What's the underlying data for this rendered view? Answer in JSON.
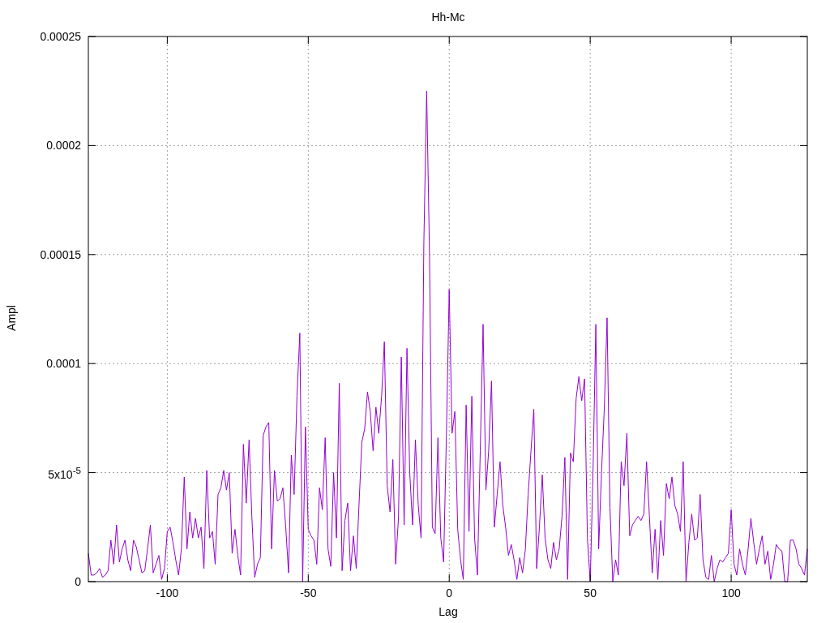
{
  "chart": {
    "chart_data": {
      "type": "line",
      "title": "Hh-Mc",
      "xlabel": "Lag",
      "ylabel": "Ampl",
      "x": [
        -128,
        -127,
        -126,
        -125,
        -124,
        -123,
        -122,
        -121,
        -120,
        -119,
        -118,
        -117,
        -116,
        -115,
        -114,
        -113,
        -112,
        -111,
        -110,
        -109,
        -108,
        -107,
        -106,
        -105,
        -104,
        -103,
        -102,
        -101,
        -100,
        -99,
        -98,
        -97,
        -96,
        -95,
        -94,
        -93,
        -92,
        -91,
        -90,
        -89,
        -88,
        -87,
        -86,
        -85,
        -84,
        -83,
        -82,
        -81,
        -80,
        -79,
        -78,
        -77,
        -76,
        -75,
        -74,
        -73,
        -72,
        -71,
        -70,
        -69,
        -68,
        -67,
        -66,
        -65,
        -64,
        -63,
        -62,
        -61,
        -60,
        -59,
        -58,
        -57,
        -56,
        -55,
        -54,
        -53,
        -52,
        -51,
        -50,
        -49,
        -48,
        -47,
        -46,
        -45,
        -44,
        -43,
        -42,
        -41,
        -40,
        -39,
        -38,
        -37,
        -36,
        -35,
        -34,
        -33,
        -32,
        -31,
        -30,
        -29,
        -28,
        -27,
        -26,
        -25,
        -24,
        -23,
        -22,
        -21,
        -20,
        -19,
        -18,
        -17,
        -16,
        -15,
        -14,
        -13,
        -12,
        -11,
        -10,
        -9,
        -8,
        -7,
        -6,
        -5,
        -4,
        -3,
        -2,
        -1,
        0,
        1,
        2,
        3,
        4,
        5,
        6,
        7,
        8,
        9,
        10,
        11,
        12,
        13,
        14,
        15,
        16,
        17,
        18,
        19,
        20,
        21,
        22,
        23,
        24,
        25,
        26,
        27,
        28,
        29,
        30,
        31,
        32,
        33,
        34,
        35,
        36,
        37,
        38,
        39,
        40,
        41,
        42,
        43,
        44,
        45,
        46,
        47,
        48,
        49,
        50,
        51,
        52,
        53,
        54,
        55,
        56,
        57,
        58,
        59,
        60,
        61,
        62,
        63,
        64,
        65,
        66,
        67,
        68,
        69,
        70,
        71,
        72,
        73,
        74,
        75,
        76,
        77,
        78,
        79,
        80,
        81,
        82,
        83,
        84,
        85,
        86,
        87,
        88,
        89,
        90,
        91,
        92,
        93,
        94,
        95,
        96,
        97,
        98,
        99,
        100,
        101,
        102,
        103,
        104,
        105,
        106,
        107,
        108,
        109,
        110,
        111,
        112,
        113,
        114,
        115,
        116,
        117,
        118,
        119,
        120,
        121,
        122,
        123,
        124,
        125,
        126,
        127
      ],
      "grid": true,
      "series": [
        {
          "color": "#9400d3",
          "values": [
            1.3e-05,
            3e-06,
            3e-06,
            4e-06,
            6e-06,
            2e-06,
            3e-06,
            5e-06,
            1.9e-05,
            8e-06,
            2.6e-05,
            9e-06,
            1.5e-05,
            1.9e-05,
            1e-05,
            5e-06,
            1.9e-05,
            1.6e-05,
            1e-05,
            4e-06,
            5e-06,
            1.5e-05,
            2.6e-05,
            4e-06,
            8e-06,
            1.2e-05,
            1e-06,
            6e-06,
            2.3e-05,
            2.5e-05,
            1.8e-05,
            1e-05,
            3e-06,
            1.5e-05,
            4.8e-05,
            1.5e-05,
            3.2e-05,
            2e-05,
            2.9e-05,
            2e-05,
            2.5e-05,
            6e-06,
            5.1e-05,
            2e-05,
            2.3e-05,
            8e-06,
            4e-05,
            4.3e-05,
            5.1e-05,
            4.2e-05,
            5e-05,
            1.3e-05,
            2.4e-05,
            1.2e-05,
            3e-06,
            6.3e-05,
            3.6e-05,
            6.5e-05,
            3e-05,
            2e-06,
            8e-06,
            1.1e-05,
            6.7e-05,
            7.1e-05,
            7.3e-05,
            1.5e-05,
            5.1e-05,
            3.7e-05,
            3.8e-05,
            4.3e-05,
            2.5e-05,
            4e-06,
            5.8e-05,
            4e-05,
            8.5e-05,
            0.000114,
            0,
            7.1e-05,
            2.4e-05,
            2.1e-05,
            1.9e-05,
            8e-06,
            4.3e-05,
            3.3e-05,
            6.6e-05,
            1.5e-05,
            7e-06,
            5e-05,
            2e-05,
            9.1e-05,
            5e-06,
            2.8e-05,
            3.6e-05,
            5e-06,
            2.1e-05,
            6e-06,
            3.5e-05,
            6.4e-05,
            7e-05,
            8.7e-05,
            7.8e-05,
            6e-05,
            8e-05,
            6.8e-05,
            8.5e-05,
            0.00011,
            4.4e-05,
            3.2e-05,
            5.6e-05,
            8e-06,
            2.9e-05,
            0.000103,
            2.6e-05,
            0.000107,
            5e-05,
            2.6e-05,
            6.5e-05,
            3.5e-05,
            2e-05,
            0.000155,
            0.000225,
            0.00015,
            2.5e-05,
            2.2e-05,
            6.6e-05,
            2e-05,
            9e-06,
            6.8e-05,
            0.000134,
            6.8e-05,
            7.8e-05,
            2.4e-05,
            1e-05,
            1e-06,
            8.1e-05,
            2.3e-05,
            8.5e-05,
            2e-05,
            3e-06,
            6e-05,
            0.000118,
            4.2e-05,
            6e-05,
            9.2e-05,
            2.5e-05,
            4e-05,
            5.5e-05,
            3.5e-05,
            2.5e-05,
            1.2e-05,
            1.7e-05,
            1e-05,
            1e-06,
            1.1e-05,
            4e-06,
            1.5e-05,
            4e-05,
            6e-05,
            7.9e-05,
            6e-06,
            2.5e-05,
            4.9e-05,
            2e-05,
            1e-05,
            6e-06,
            1.8e-05,
            1e-05,
            1.5e-05,
            3e-05,
            5.7e-05,
            1e-06,
            5.9e-05,
            5.5e-05,
            8.4e-05,
            9.4e-05,
            8.3e-05,
            9.3e-05,
            2e-05,
            0,
            5e-05,
            0.000118,
            1.5e-05,
            5e-05,
            8e-05,
            0.000121,
            3.4e-05,
            0,
            1e-05,
            3e-06,
            5.5e-05,
            4.4e-05,
            6.8e-05,
            2.1e-05,
            2.6e-05,
            2.8e-05,
            3e-05,
            2.8e-05,
            3.1e-05,
            5.5e-05,
            3e-05,
            4e-06,
            2.4e-05,
            1e-06,
            2.8e-05,
            1.2e-05,
            4.5e-05,
            3.8e-05,
            4.8e-05,
            3.5e-05,
            3.1e-05,
            2.3e-05,
            5.5e-05,
            0,
            1.8e-05,
            3.1e-05,
            1.9e-05,
            2e-05,
            4e-05,
            1e-05,
            2e-06,
            1e-06,
            1.2e-05,
            0,
            6e-06,
            1e-05,
            9e-06,
            1.1e-05,
            1.3e-05,
            3.3e-05,
            8e-06,
            3e-06,
            1.5e-05,
            8e-06,
            3e-06,
            1.5e-05,
            2.9e-05,
            1.8e-05,
            8e-06,
            1.5e-05,
            2.1e-05,
            8e-06,
            1.4e-05,
            1e-06,
            8e-06,
            1.7e-05,
            1.5e-05,
            1.4e-05,
            0,
            0,
            1.9e-05,
            1.9e-05,
            1.5e-05,
            8e-06,
            6e-06,
            3e-06,
            1.5e-05
          ]
        }
      ],
      "xlim": [
        -128,
        127
      ],
      "ylim": [
        0,
        0.00025
      ],
      "xticks": [
        -100,
        -50,
        0,
        50,
        100
      ],
      "yticks": [
        0,
        {
          "value": 5e-05,
          "label": "5x10$^{-5}$"
        },
        0.0001,
        0.00015,
        0.0002,
        0.00025
      ]
    }
  }
}
